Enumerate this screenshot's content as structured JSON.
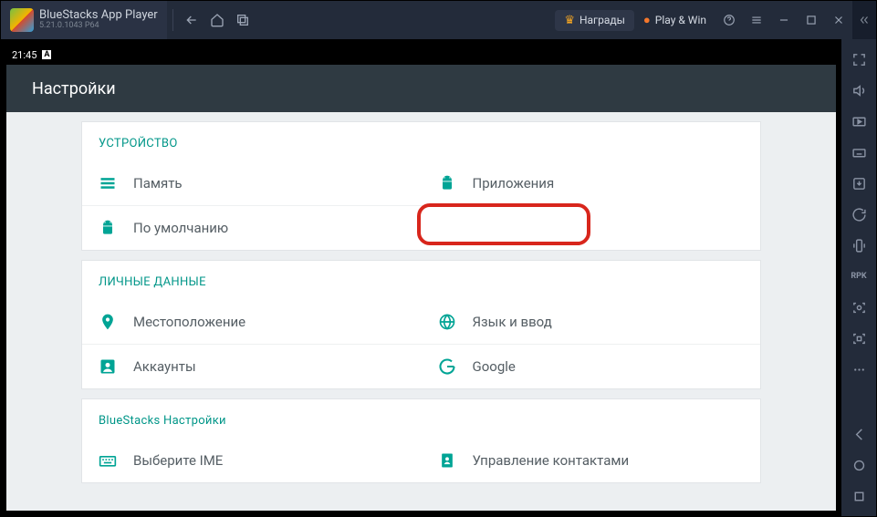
{
  "titlebar": {
    "app_name": "BlueStacks App Player",
    "version": "5.21.0.1043 P64",
    "rewards": "Награды",
    "playwin": "Play & Win"
  },
  "statusbar": {
    "time": "21:45"
  },
  "appbar": {
    "title": "Настройки"
  },
  "sections": {
    "device": {
      "header": "УСТРОЙСТВО",
      "memory": "Память",
      "apps": "Приложения",
      "default": "По умолчанию"
    },
    "personal": {
      "header": "ЛИЧНЫЕ ДАННЫЕ",
      "location": "Местоположение",
      "language": "Язык и ввод",
      "accounts": "Аккаунты",
      "google": "Google"
    },
    "bluestacks": {
      "header": "BlueStacks Настройки",
      "ime": "Выберите IME",
      "contacts": "Управление контактами"
    }
  }
}
